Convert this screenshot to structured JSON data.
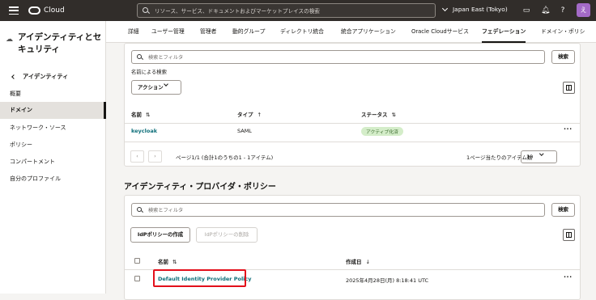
{
  "topbar": {
    "logo_text": "Cloud",
    "search_placeholder": "リソース、サービス、ドキュメントおよびマーケットプレイスの検索",
    "region": "Japan East (Tokyo)",
    "avatar_initial": "え"
  },
  "sidebar": {
    "title": "アイデンティティとセキュリティ",
    "back_label": "アイデンティティ",
    "items": [
      {
        "label": "概要",
        "active": false
      },
      {
        "label": "ドメイン",
        "active": true
      },
      {
        "label": "ネットワーク・ソース",
        "active": false
      },
      {
        "label": "ポリシー",
        "active": false
      },
      {
        "label": "コンパートメント",
        "active": false
      },
      {
        "label": "自分のプロファイル",
        "active": false
      }
    ]
  },
  "tabs": [
    "詳細",
    "ユーザー管理",
    "管理者",
    "動的グループ",
    "ディレクトリ統合",
    "統合アプリケーション",
    "Oracle Cloudサービス",
    "フェデレーション",
    "ドメイン・ポリシ"
  ],
  "active_tab": "フェデレーション",
  "idp_card": {
    "search_placeholder": "検索とフィルタ",
    "search_button": "検索",
    "filter_label": "名前による検索",
    "action_button": "アクション",
    "columns": {
      "name": "名前",
      "type": "タイプ",
      "status": "ステータス"
    },
    "rows": [
      {
        "name": "keycloak",
        "type": "SAML",
        "status": "アクティブ化済"
      }
    ],
    "pagination": {
      "page_info": "ページ1/1 (合計1のうちの1 - 1アイテム)",
      "per_page_label": "1ページ当たりのアイテム数",
      "per_page_value": "10"
    }
  },
  "policy_section": {
    "title": "アイデンティティ・プロバイダ・ポリシー",
    "search_placeholder": "検索とフィルタ",
    "search_button": "検索",
    "create_button": "IdPポリシーの作成",
    "delete_button": "IdPポリシーの削除",
    "columns": {
      "name": "名前",
      "created": "作成日"
    },
    "rows": [
      {
        "name": "Default Identity Provider Policy",
        "created": "2025年4月28日(月) 8:18:41 UTC"
      }
    ]
  }
}
